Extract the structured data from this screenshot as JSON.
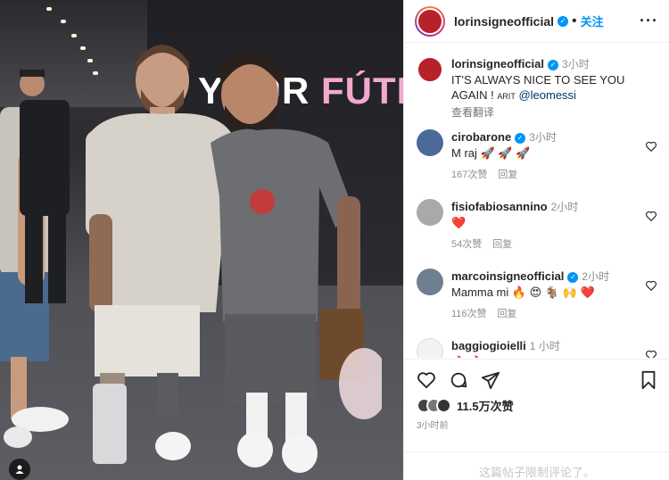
{
  "header": {
    "username": "lorinsigneofficial",
    "follow_label": "关注",
    "more_icon": "more-horizontal-icon"
  },
  "photo": {
    "wall_text_prefix": "YOUR ",
    "wall_text_highlight": "FÚTI"
  },
  "caption": {
    "username": "lorinsigneofficial",
    "time": "3小时",
    "text": "IT'S ALWAYS NICE TO SEE YOU AGAIN !",
    "tag": "ARIT",
    "mention": "@leomessi",
    "translate_label": "查看翻译"
  },
  "comments": [
    {
      "username": "cirobarone",
      "verified": true,
      "time": "3小时",
      "text": "M raj 🚀 🚀 🚀",
      "likes": "167次赞",
      "reply": "回复"
    },
    {
      "username": "fisiofabiosannino",
      "verified": false,
      "time": "2小时",
      "text": "❤️",
      "likes": "54次赞",
      "reply": "回复"
    },
    {
      "username": "marcoinsigneofficial",
      "verified": true,
      "time": "2小时",
      "text": "Mamma mi 🔥 😍 🐐 🙌 ❤️",
      "likes": "116次赞",
      "reply": "回复"
    },
    {
      "username": "baggiogioielli",
      "verified": false,
      "time": "1 小时",
      "text": "🔥 🔥",
      "likes": "",
      "reply": ""
    }
  ],
  "actions": {
    "like_icon": "heart-icon",
    "comment_icon": "comment-icon",
    "share_icon": "share-icon",
    "save_icon": "bookmark-icon",
    "likes_count": "11.5万次赞",
    "post_time": "3小时前",
    "comments_limited": "这篇帖子限制评论了。"
  },
  "colors": {
    "accent": "#0095f6",
    "like_red": "#ed4956"
  }
}
